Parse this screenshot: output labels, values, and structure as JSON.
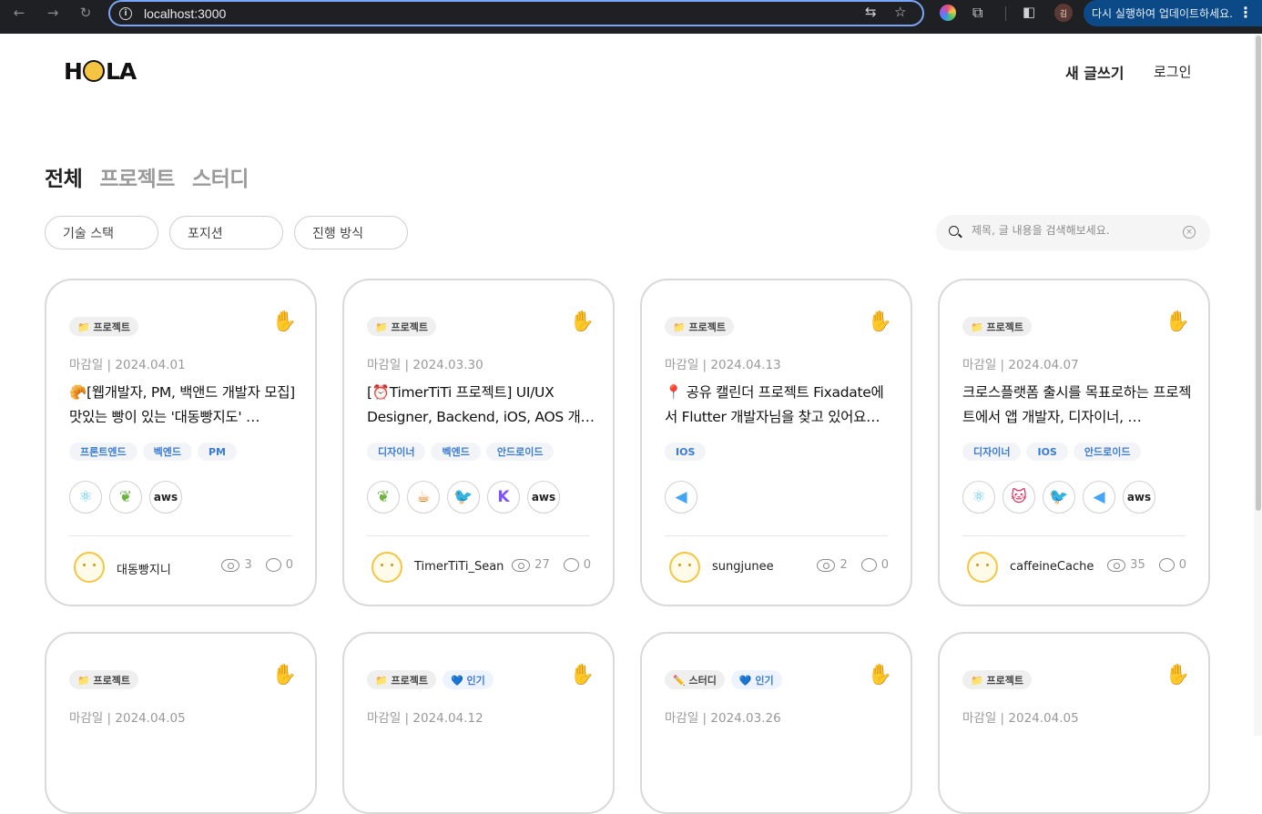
{
  "browser": {
    "url": "localhost:3000",
    "profile_initial": "김",
    "update_label": "다시 실행하여 업데이트하세요.",
    "menu_icon": "⋮"
  },
  "header": {
    "logo_text": "HOLA",
    "new_post": "새 글쓰기",
    "login": "로그인"
  },
  "categories": [
    {
      "label": "전체"
    },
    {
      "label": "프로젝트"
    },
    {
      "label": "스터디"
    }
  ],
  "filters": [
    {
      "label": "기술 스택"
    },
    {
      "label": "포지션"
    },
    {
      "label": "진행 방식"
    }
  ],
  "search": {
    "placeholder": "제목, 글 내용을 검색해보세요."
  },
  "cards": [
    {
      "badges": [
        {
          "label": "📁 프로젝트"
        }
      ],
      "deadline": "마감일 | 2024.04.01",
      "title": "🥐[웹개발자, PM, 백앤드 개발자 모집] 맛있는 빵이 있는 '대동빵지도' …",
      "positions": [
        "프론트엔드",
        "벡엔드",
        "PM"
      ],
      "stacks": [
        {
          "name": "react",
          "glyph": "⚛",
          "color": "#5ac8ec"
        },
        {
          "name": "spring",
          "glyph": "❦",
          "color": "#6db33f"
        },
        {
          "name": "aws",
          "glyph": "aws",
          "color": "#222"
        }
      ],
      "author": "대동빵지니",
      "views": "3",
      "comments": "0"
    },
    {
      "badges": [
        {
          "label": "📁 프로젝트"
        }
      ],
      "deadline": "마감일 | 2024.03.30",
      "title": "[⏰TimerTiTi 프로젝트] UI/UX Designer, Backend, iOS, AOS 개…",
      "positions": [
        "디자이너",
        "벡엔드",
        "안드로이드"
      ],
      "stacks": [
        {
          "name": "spring",
          "glyph": "❦",
          "color": "#6db33f"
        },
        {
          "name": "java",
          "glyph": "☕",
          "color": "#e76f00"
        },
        {
          "name": "swift",
          "glyph": "🐦",
          "color": "#f05138"
        },
        {
          "name": "kotlin",
          "glyph": "K",
          "color": "#7f52ff"
        },
        {
          "name": "aws",
          "glyph": "aws",
          "color": "#222"
        }
      ],
      "author": "TimerTiTi_Sean",
      "views": "27",
      "comments": "0"
    },
    {
      "badges": [
        {
          "label": "📁 프로젝트"
        }
      ],
      "deadline": "마감일 | 2024.04.13",
      "title": "📍 공유 캘린더 프로젝트 Fixadate에서 Flutter 개발자님을 찾고 있어요…",
      "positions": [
        "IOS"
      ],
      "stacks": [
        {
          "name": "flutter",
          "glyph": "◀",
          "color": "#42a5f5"
        }
      ],
      "author": "sungjunee",
      "views": "2",
      "comments": "0"
    },
    {
      "badges": [
        {
          "label": "📁 프로젝트"
        }
      ],
      "deadline": "마감일 | 2024.04.07",
      "title": "크로스플랫폼 출시를 목표로하는 프로젝트에서 앱 개발자, 디자이너, …",
      "positions": [
        "디자이너",
        "IOS",
        "안드로이드"
      ],
      "stacks": [
        {
          "name": "react",
          "glyph": "⚛",
          "color": "#5ac8ec"
        },
        {
          "name": "nestjs",
          "glyph": "🐱",
          "color": "#e0234e"
        },
        {
          "name": "swift",
          "glyph": "🐦",
          "color": "#f05138"
        },
        {
          "name": "flutter",
          "glyph": "◀",
          "color": "#42a5f5"
        },
        {
          "name": "aws",
          "glyph": "aws",
          "color": "#222"
        }
      ],
      "author": "caffeineCache",
      "views": "35",
      "comments": "0"
    },
    {
      "badges": [
        {
          "label": "📁 프로젝트"
        }
      ],
      "deadline": "마감일 | 2024.04.05"
    },
    {
      "badges": [
        {
          "label": "📁 프로젝트"
        },
        {
          "label": "💙 인기",
          "hot": true
        }
      ],
      "deadline": "마감일 | 2024.04.12"
    },
    {
      "badges": [
        {
          "label": "✏️ 스터디"
        },
        {
          "label": "💙 인기",
          "hot": true
        }
      ],
      "deadline": "마감일 | 2024.03.26"
    },
    {
      "badges": [
        {
          "label": "📁 프로젝트"
        }
      ],
      "deadline": "마감일 | 2024.04.05"
    }
  ],
  "colors": {
    "accent": "#3a7bd5",
    "logo_yellow": "#f5c542",
    "chrome_bg": "#1f2023",
    "update_bg": "#0b4a86"
  }
}
